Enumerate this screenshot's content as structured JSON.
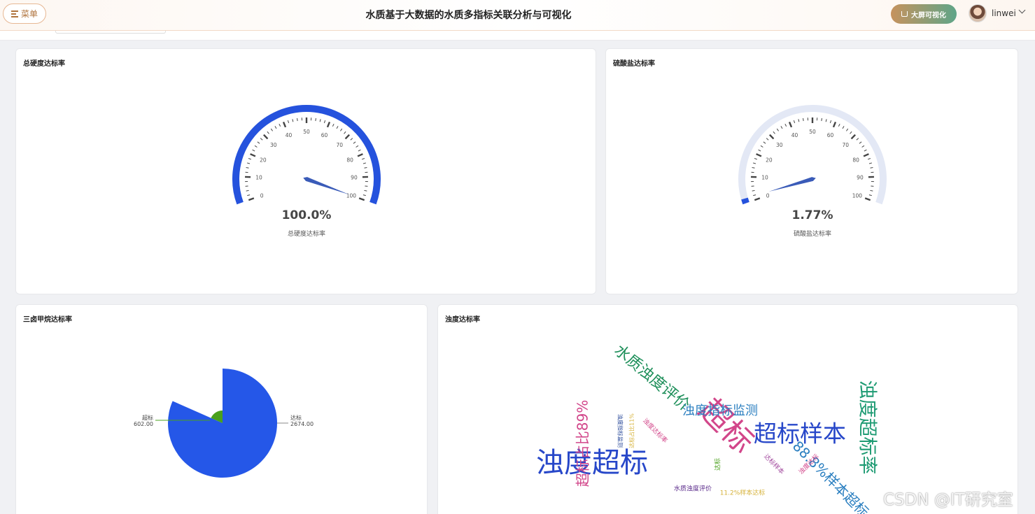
{
  "header": {
    "menu_label": "菜单",
    "title": "水质基于大数据的水质多指标关联分析与可视化",
    "bigscreen_label": "大屏可视化",
    "username": "linwei"
  },
  "gauges": [
    {
      "title": "总硬度达标率",
      "value": 100.0,
      "value_text": "100.0%",
      "label": "总硬度达标率",
      "ticks": [
        "0",
        "10",
        "20",
        "30",
        "40",
        "50",
        "60",
        "70",
        "80",
        "90",
        "100"
      ]
    },
    {
      "title": "硫酸盐达标率",
      "value": 1.77,
      "value_text": "1.77%",
      "label": "硫酸盐达标率",
      "ticks": [
        "0",
        "10",
        "20",
        "30",
        "40",
        "50",
        "60",
        "70",
        "80",
        "90",
        "100"
      ]
    }
  ],
  "pie_card": {
    "title": "三卤甲烷达标率"
  },
  "wordcloud_card": {
    "title": "浊度达标率"
  },
  "chart_data": [
    {
      "type": "gauge",
      "title": "总硬度达标率",
      "value": 100.0,
      "min": 0,
      "max": 100,
      "unit": "%"
    },
    {
      "type": "gauge",
      "title": "硫酸盐达标率",
      "value": 1.77,
      "min": 0,
      "max": 100,
      "unit": "%"
    },
    {
      "type": "pie",
      "title": "三卤甲烷达标率",
      "rose": true,
      "slices": [
        {
          "name": "超标",
          "value": 602.0,
          "value_text": "602.00",
          "color": "#4aa01c"
        },
        {
          "name": "达标",
          "value": 2674.0,
          "value_text": "2674.00",
          "color": "#2557e8"
        }
      ]
    },
    {
      "type": "wordcloud",
      "title": "浊度达标率",
      "words": [
        {
          "text": "浊度超标",
          "color": "#2747c9"
        },
        {
          "text": "超标",
          "color": "#d2468a"
        },
        {
          "text": "超标样本",
          "color": "#2747c9"
        },
        {
          "text": "水质浊度评价",
          "color": "#1e8f5a"
        },
        {
          "text": "浊度指标监测",
          "color": "#2b7fc0"
        },
        {
          "text": "浊度超标率",
          "color": "#1e9b73"
        },
        {
          "text": "超标占比89%",
          "color": "#d2468a"
        },
        {
          "text": "88.8%样本超标",
          "color": "#2b7fc0"
        },
        {
          "text": "浊度达标率",
          "color": "#d2468a"
        },
        {
          "text": "浊度达标",
          "color": "#d2468a"
        },
        {
          "text": "达标样本",
          "color": "#a24a9e"
        },
        {
          "text": "达标",
          "color": "#4aa01c"
        },
        {
          "text": "水质浊度评价",
          "color": "#5a2a8a"
        },
        {
          "text": "11.2%样本达标",
          "color": "#d6b23a"
        },
        {
          "text": "浊度指标监测",
          "color": "#2a4a9a"
        },
        {
          "text": "达标占比11%",
          "color": "#d6b23a"
        }
      ]
    }
  ],
  "watermark": "CSDN @IT研究室"
}
